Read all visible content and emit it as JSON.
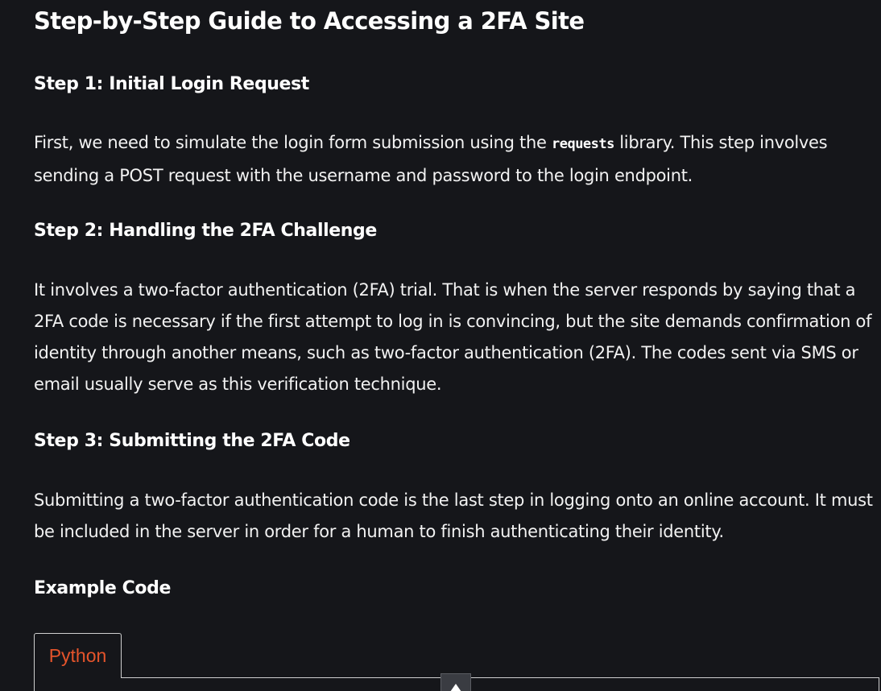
{
  "article": {
    "title": "Step-by-Step Guide to Accessing a 2FA Site",
    "step1": {
      "heading": "Step 1: Initial Login Request",
      "text_before": "First, we need to simulate the login form submission using the ",
      "code": "requests",
      "text_after": " library. This step involves sending a POST request with the username and password to the login endpoint."
    },
    "step2": {
      "heading": "Step 2: Handling the 2FA Challenge",
      "text": "It involves a two-factor authentication (2FA) trial. That is when the server responds by saying that a 2FA code is necessary if the first attempt to log in is convincing, but the site demands confirmation of identity through another means, such as two-factor authentication (2FA). The codes sent via SMS or email usually serve as this verification technique."
    },
    "step3": {
      "heading": "Step 3: Submitting the 2FA Code",
      "text": "Submitting a two-factor authentication code is the last step in logging onto an online account. It must be included in the server in order for a human to finish authenticating their identity."
    },
    "example_heading": "Example Code"
  },
  "code_tabs": {
    "active_label": "Python"
  },
  "icons": {
    "scroll_up": "chevron-up-icon"
  },
  "colors": {
    "background": "#15161a",
    "tab_accent": "#e5542b"
  }
}
